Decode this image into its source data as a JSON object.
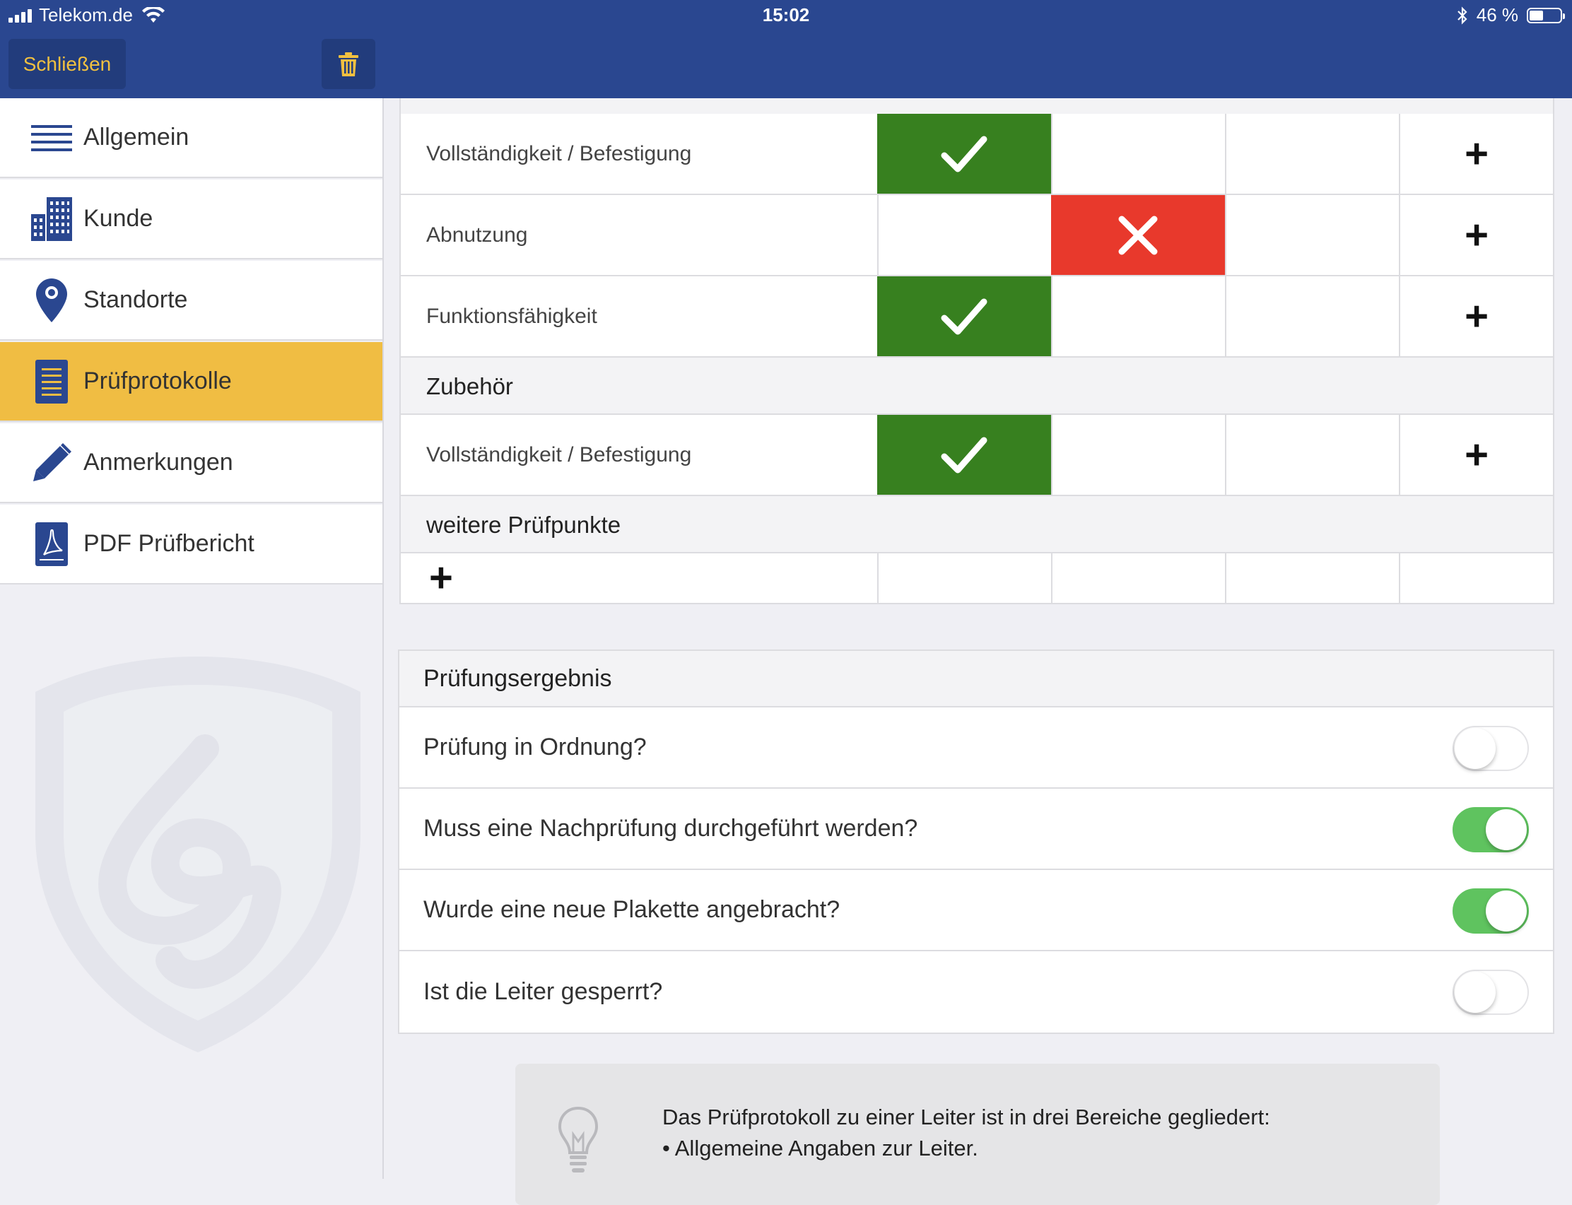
{
  "status": {
    "carrier": "Telekom.de",
    "time": "15:02",
    "battery": "46 %",
    "battery_level": 0.46
  },
  "header": {
    "close_label": "Schließen",
    "trash_icon": "trash-icon"
  },
  "sidebar": {
    "items": [
      {
        "label": "Allgemein",
        "icon": "list-icon",
        "active": false
      },
      {
        "label": "Kunde",
        "icon": "building-icon",
        "active": false
      },
      {
        "label": "Standorte",
        "icon": "map-pin-icon",
        "active": false
      },
      {
        "label": "Prüfprotokolle",
        "icon": "document-icon",
        "active": true
      },
      {
        "label": "Anmerkungen",
        "icon": "pencil-icon",
        "active": false
      },
      {
        "label": "PDF Prüfbericht",
        "icon": "pdf-icon",
        "active": false
      }
    ]
  },
  "checklist": {
    "rows": [
      {
        "label": "Vollständigkeit / Befestigung",
        "status": "ok"
      },
      {
        "label": "Abnutzung",
        "status": "nok"
      },
      {
        "label": "Funktionsfähigkeit",
        "status": "ok"
      }
    ],
    "sections": [
      {
        "title": "Zubehör",
        "rows": [
          {
            "label": "Vollständigkeit / Befestigung",
            "status": "ok"
          }
        ]
      },
      {
        "title": "weitere Prüfpunkte"
      }
    ]
  },
  "result": {
    "title": "Prüfungsergebnis",
    "questions": [
      {
        "label": "Prüfung in Ordnung?",
        "on": false
      },
      {
        "label": "Muss eine Nachprüfung durchgeführt werden?",
        "on": true
      },
      {
        "label": "Wurde eine neue Plakette angebracht?",
        "on": true
      },
      {
        "label": "Ist die Leiter gesperrt?",
        "on": false
      }
    ]
  },
  "tip": {
    "line1": "Das Prüfprotokoll zu einer Leiter ist in drei Bereiche gegliedert:",
    "line2": "• Allgemeine Angaben zur Leiter."
  },
  "colors": {
    "header": "#2a4790",
    "accent": "#f0bd43",
    "ok": "#37801f",
    "nok": "#e8392c",
    "toggle_on": "#5fc35f"
  }
}
